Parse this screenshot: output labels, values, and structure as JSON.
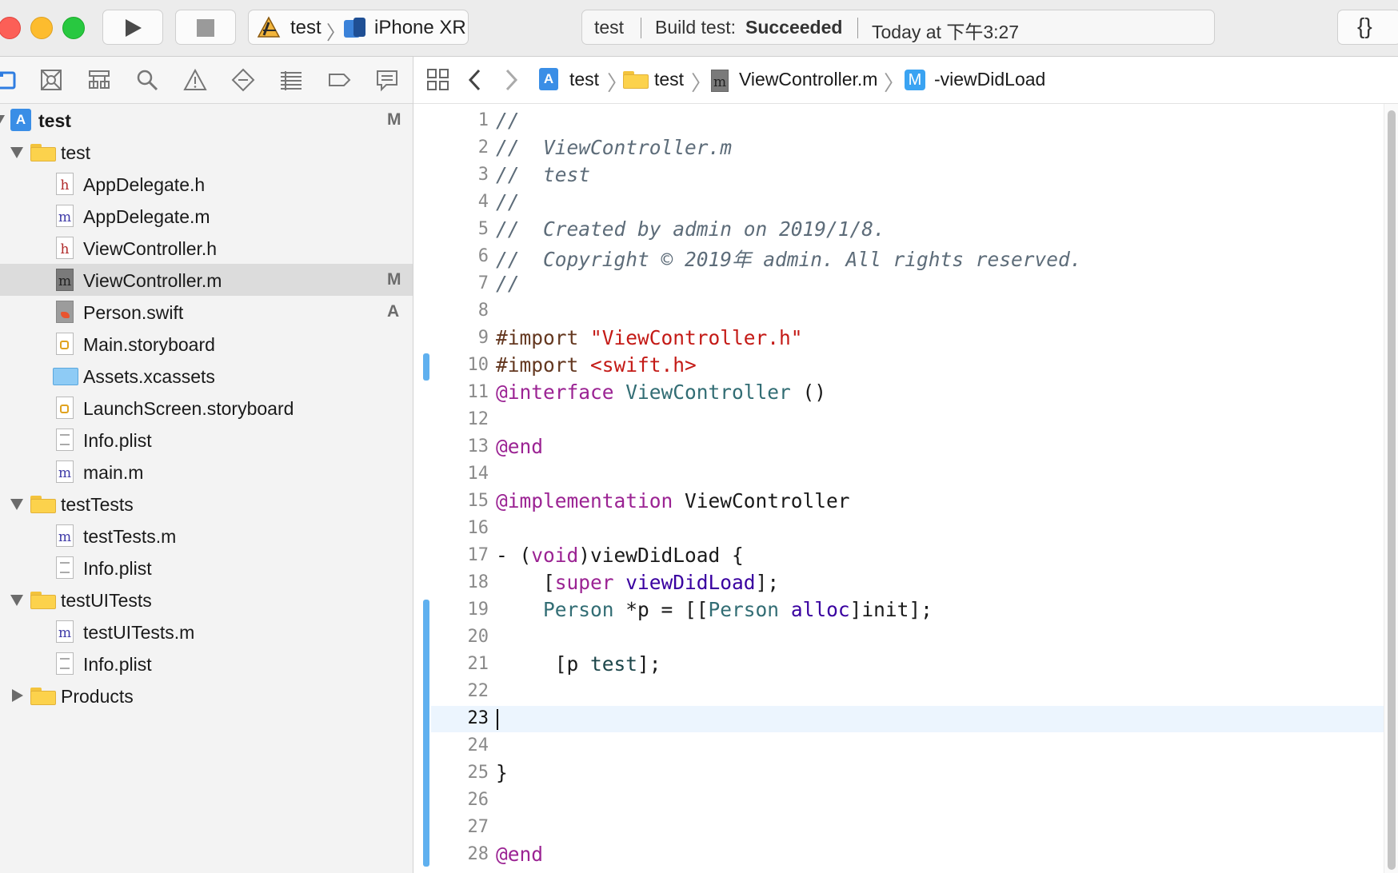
{
  "toolbar": {
    "scheme_name": "test",
    "device_name": "iPhone XR",
    "activity": {
      "project": "test",
      "build_label": "Build test:",
      "build_status": "Succeeded",
      "time": "Today at 下午3:27"
    },
    "editor_toggle": "{}"
  },
  "navigator": {
    "tabs": [
      "project-navigator",
      "source-control-navigator",
      "symbol-navigator",
      "find-navigator",
      "issue-navigator",
      "test-navigator",
      "debug-navigator",
      "breakpoint-navigator",
      "report-navigator"
    ],
    "tree": [
      {
        "label": "test",
        "badge": "M",
        "icon": "project-icon"
      },
      {
        "label": "test",
        "badge": "",
        "icon": "folder-icon"
      },
      {
        "label": "AppDelegate.h",
        "badge": "",
        "icon": "header-file-icon"
      },
      {
        "label": "AppDelegate.m",
        "badge": "",
        "icon": "objc-file-icon"
      },
      {
        "label": "ViewController.h",
        "badge": "",
        "icon": "header-file-icon"
      },
      {
        "label": "ViewController.m",
        "badge": "M",
        "icon": "objc-file-icon"
      },
      {
        "label": "Person.swift",
        "badge": "A",
        "icon": "swift-file-icon"
      },
      {
        "label": "Main.storyboard",
        "badge": "",
        "icon": "storyboard-icon"
      },
      {
        "label": "Assets.xcassets",
        "badge": "",
        "icon": "assets-icon"
      },
      {
        "label": "LaunchScreen.storyboard",
        "badge": "",
        "icon": "storyboard-icon"
      },
      {
        "label": "Info.plist",
        "badge": "",
        "icon": "plist-icon"
      },
      {
        "label": "main.m",
        "badge": "",
        "icon": "objc-file-icon"
      },
      {
        "label": "testTests",
        "badge": "",
        "icon": "folder-icon"
      },
      {
        "label": "testTests.m",
        "badge": "",
        "icon": "objc-file-icon"
      },
      {
        "label": "Info.plist",
        "badge": "",
        "icon": "plist-icon"
      },
      {
        "label": "testUITests",
        "badge": "",
        "icon": "folder-icon"
      },
      {
        "label": "testUITests.m",
        "badge": "",
        "icon": "objc-file-icon"
      },
      {
        "label": "Info.plist",
        "badge": "",
        "icon": "plist-icon"
      },
      {
        "label": "Products",
        "badge": "",
        "icon": "folder-icon"
      }
    ],
    "selected": "ViewController.m"
  },
  "jumpbar": {
    "crumbs": [
      "test",
      "test",
      "ViewController.m",
      "-viewDidLoad"
    ],
    "method_badge": "M"
  },
  "editor": {
    "current_line": 23,
    "line_numbers": [
      "1",
      "2",
      "3",
      "4",
      "5",
      "6",
      "7",
      "8",
      "9",
      "10",
      "11",
      "12",
      "13",
      "14",
      "15",
      "16",
      "17",
      "18",
      "19",
      "20",
      "21",
      "22",
      "23",
      "24",
      "25",
      "26",
      "27",
      "28"
    ],
    "code": {
      "l1": "//",
      "l2": "//  ViewController.m",
      "l3": "//  test",
      "l4": "//",
      "l5": "//  Created by admin on 2019/1/8.",
      "l6": "//  Copyright © 2019年 admin. All rights reserved.",
      "l7": "//",
      "l9_directive": "#import ",
      "l9_path": "\"ViewController.h\"",
      "l10_directive": "#import ",
      "l10_path": "<swift.h>",
      "l11_kw": "@interface",
      "l11_cls": "ViewController",
      "l11_rest": " ()",
      "l13_kw": "@end",
      "l15_kw": "@implementation",
      "l15_rest": " ViewController",
      "l17_a": "- (",
      "l17_kw": "void",
      "l17_b": ")viewDidLoad {",
      "l18_a": "    [",
      "l18_kw": "super",
      "l18_meth": "viewDidLoad",
      "l18_b": "];",
      "l19_cls1": "Person",
      "l19_a": " *p = [[",
      "l19_cls2": "Person",
      "l19_meth": "alloc",
      "l19_b": "]init];",
      "l21_a": "     [p ",
      "l21_meth": "test",
      "l21_b": "];",
      "l25": "}",
      "l28_kw": "@end"
    }
  },
  "colors": {
    "comment": "#5d6c79",
    "keyword": "#9b2393",
    "string": "#c41a16",
    "class": "#326d74",
    "preprocessor": "#643820",
    "change_bar": "#5fb0ef",
    "build_success": "#333333"
  }
}
